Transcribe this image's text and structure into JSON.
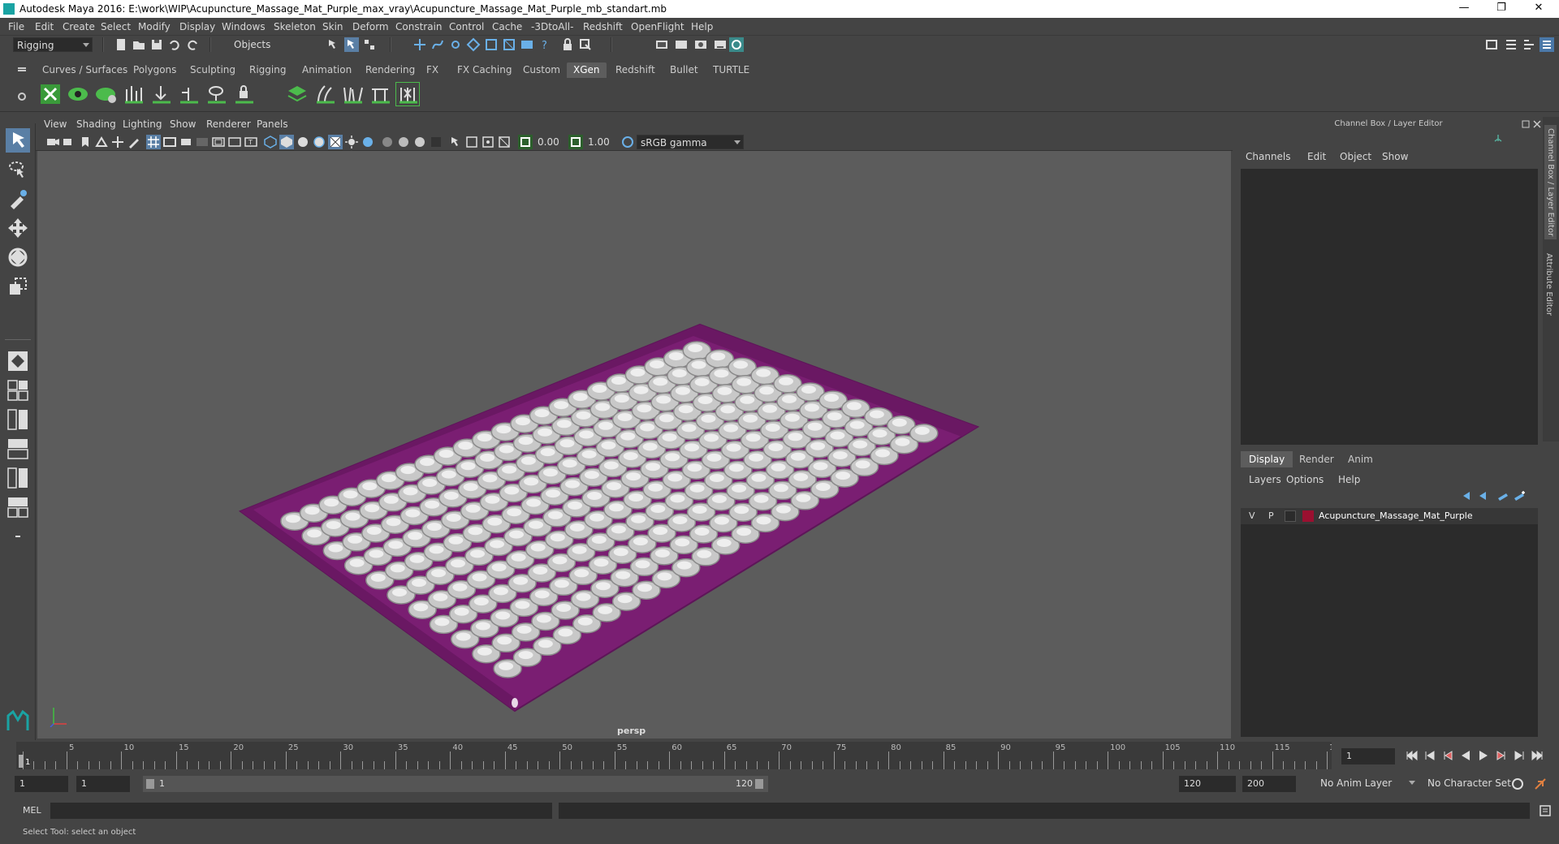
{
  "window": {
    "title": "Autodesk Maya 2016: E:\\work\\WIP\\Acupuncture_Massage_Mat_Purple_max_vray\\Acupuncture_Massage_Mat_Purple_mb_standart.mb",
    "minimize": "—",
    "maximize": "❐",
    "close": "✕"
  },
  "menubar": [
    "File",
    "Edit",
    "Create",
    "Select",
    "Modify",
    "Display",
    "Windows",
    "Skeleton",
    "Skin",
    "Deform",
    "Constrain",
    "Control",
    "Cache",
    "-3DtoAll-",
    "Redshift",
    "OpenFlight",
    "Help"
  ],
  "statusline": {
    "menuset": "Rigging",
    "selection_mode": "Objects"
  },
  "shelf_tabs": [
    "Curves / Surfaces",
    "Polygons",
    "Sculpting",
    "Rigging",
    "Animation",
    "Rendering",
    "FX",
    "FX Caching",
    "Custom",
    "XGen",
    "Redshift",
    "Bullet",
    "TURTLE"
  ],
  "shelf_active": "XGen",
  "viewport": {
    "menus": [
      "View",
      "Shading",
      "Lighting",
      "Show",
      "Renderer",
      "Panels"
    ],
    "exposure": "0.00",
    "gamma": "1.00",
    "color_space": "sRGB gamma",
    "camera": "persp"
  },
  "channel_box": {
    "title": "Channel Box / Layer Editor",
    "menus": [
      "Channels",
      "Edit",
      "Object",
      "Show"
    ],
    "layer_tabs": [
      "Display",
      "Render",
      "Anim"
    ],
    "layer_active": "Display",
    "layer_menus": [
      "Layers",
      "Options",
      "Help"
    ],
    "layer": {
      "v": "V",
      "p": "P",
      "name": "Acupuncture_Massage_Mat_Purple",
      "color": "#9a1030"
    }
  },
  "side_tabs": [
    "Channel Box / Layer Editor",
    "Attribute Editor"
  ],
  "timeline": {
    "ticks": [
      "1",
      "5",
      "10",
      "15",
      "20",
      "25",
      "30",
      "35",
      "40",
      "45",
      "50",
      "55",
      "60",
      "65",
      "70",
      "75",
      "80",
      "85",
      "90",
      "95",
      "100",
      "105",
      "110",
      "115",
      "120"
    ],
    "current_frame": "1"
  },
  "range": {
    "start": "1",
    "playback_start": "1",
    "slider_start": "1",
    "slider_end": "120",
    "playback_end": "120",
    "end": "200",
    "anim_layer": "No Anim Layer",
    "char_set": "No Character Set"
  },
  "command": {
    "lang": "MEL"
  },
  "help": "Select Tool: select an object",
  "colors": {
    "mat": "#7a1e72",
    "accent": "#4a90c8"
  }
}
